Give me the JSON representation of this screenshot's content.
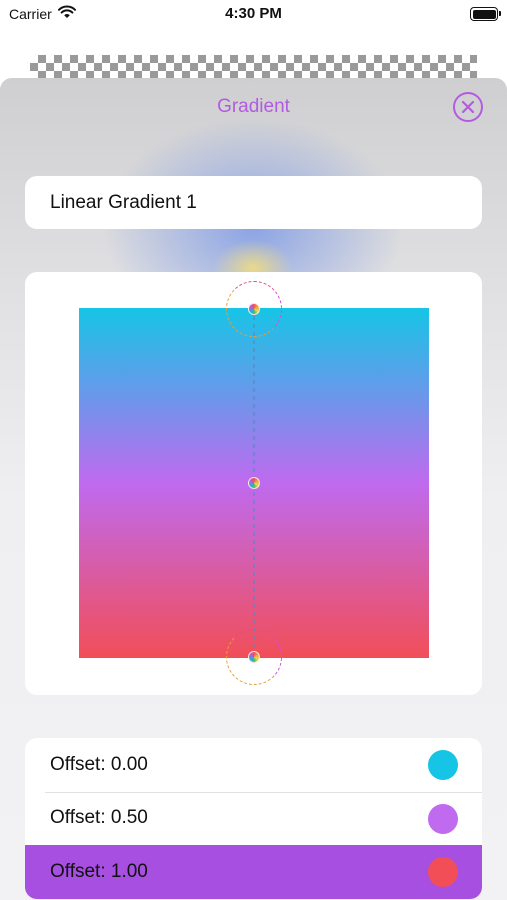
{
  "status_bar": {
    "carrier": "Carrier",
    "time": "4:30 PM",
    "icons": [
      "wifi-icon",
      "battery-icon"
    ]
  },
  "sheet": {
    "title": "Gradient",
    "title_color": "#b35be0",
    "close_icon": "close-circle-icon"
  },
  "name_field": {
    "value": "Linear Gradient 1"
  },
  "gradient": {
    "type": "linear",
    "colors": [
      "#16c5e6",
      "#bf6aef",
      "#f24e58"
    ],
    "stops": [
      0.0,
      0.5,
      1.0
    ]
  },
  "stops_list": {
    "items": [
      {
        "label": "Offset: 0.00",
        "color": "#16c5e6",
        "selected": false
      },
      {
        "label": "Offset: 0.50",
        "color": "#bf6aef",
        "selected": false
      },
      {
        "label": "Offset: 1.00",
        "color": "#f24e58",
        "selected": true
      }
    ],
    "selected_color": "#a64fe0"
  }
}
